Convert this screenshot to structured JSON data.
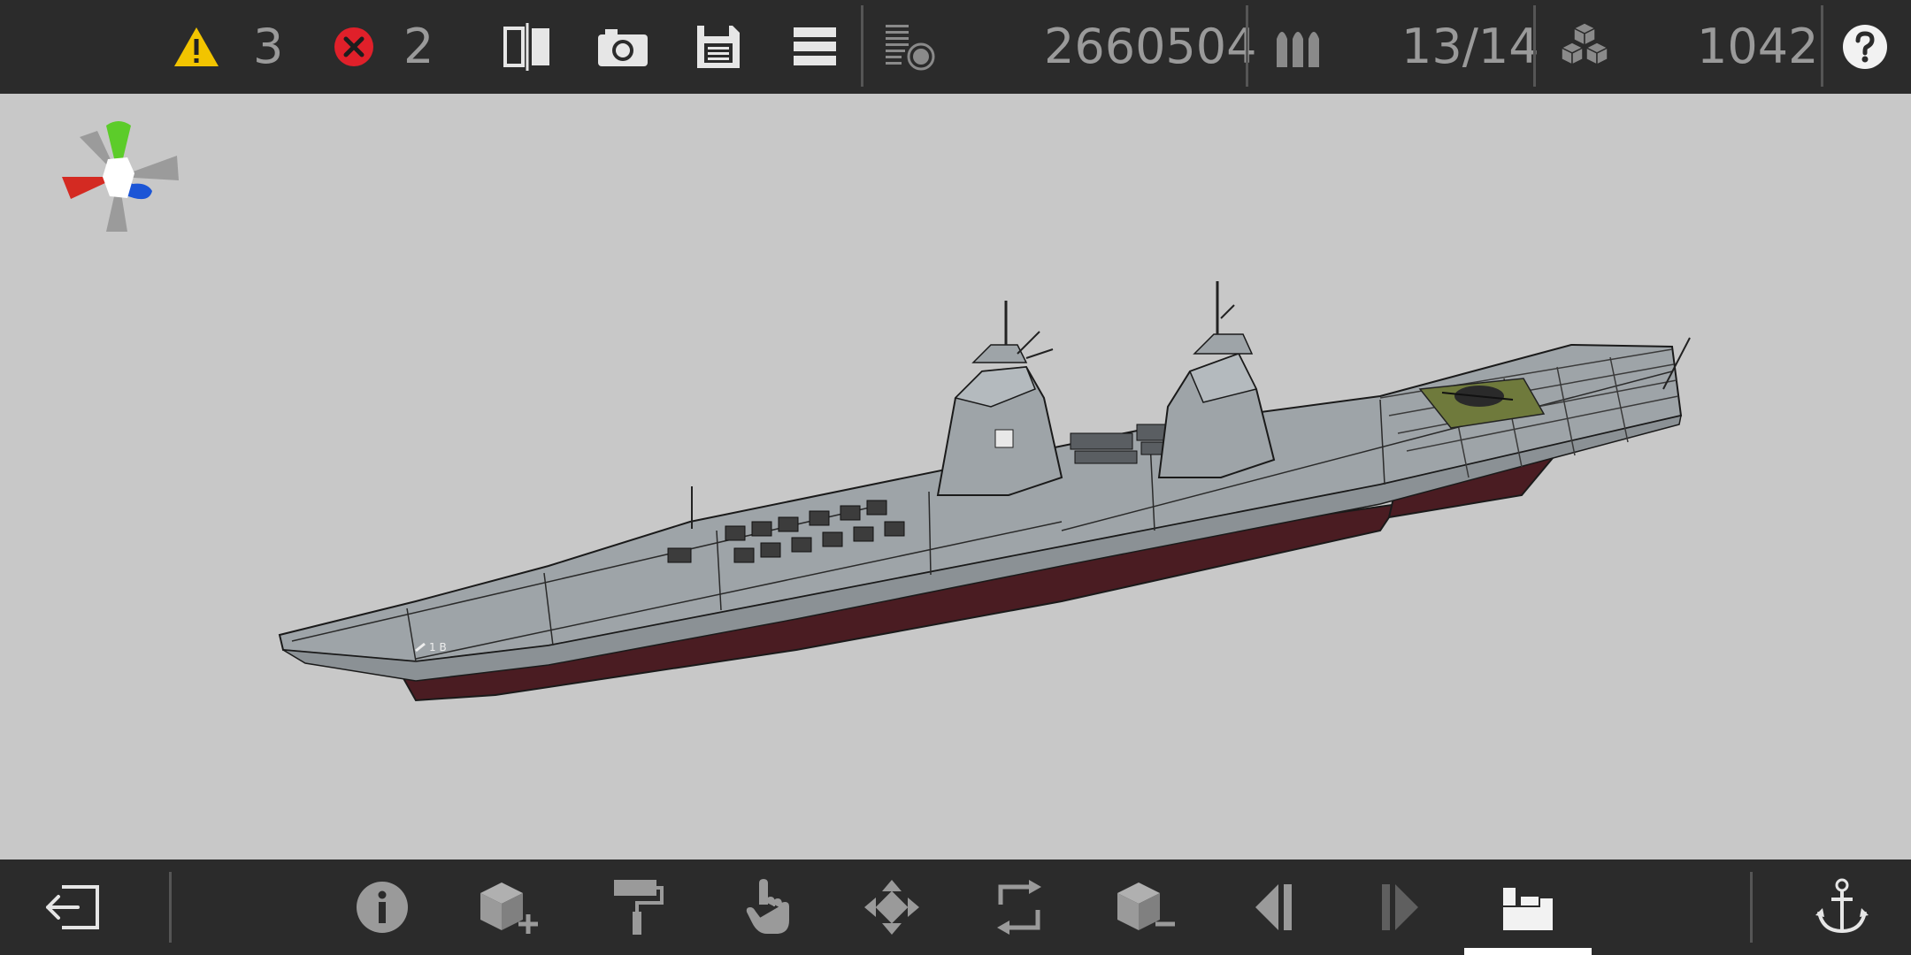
{
  "topbar": {
    "warnings_count": "3",
    "errors_count": "2",
    "mass_value": "2660504",
    "ammo_value": "13/14",
    "blocks_value": "1042"
  },
  "icons": {
    "warning": "warning-triangle-icon",
    "error": "error-x-icon",
    "mirror": "mirror-icon",
    "camera": "camera-icon",
    "save": "save-icon",
    "menu": "menu-icon",
    "layers": "layers-icon",
    "ammo": "ammo-icon",
    "blocks": "blocks-icon",
    "help": "help-icon",
    "exit": "exit-icon",
    "info": "info-icon",
    "add_block": "add-block-icon",
    "paint": "paint-roller-icon",
    "select": "hand-pointer-icon",
    "move": "move-icon",
    "rotate": "rotate-icon",
    "remove_block": "remove-block-icon",
    "undo": "undo-icon",
    "redo": "redo-icon",
    "crew": "crew-icon",
    "anchor": "anchor-icon"
  },
  "colors": {
    "warning": "#f2c400",
    "error": "#e0202a",
    "axis_x": "#d42a22",
    "axis_y": "#5ccc2a",
    "axis_z": "#1b55d6",
    "hull_deck": "#9ea4a8",
    "hull_bottom": "#4a1c22",
    "flight_pad": "#6f7a3c"
  }
}
